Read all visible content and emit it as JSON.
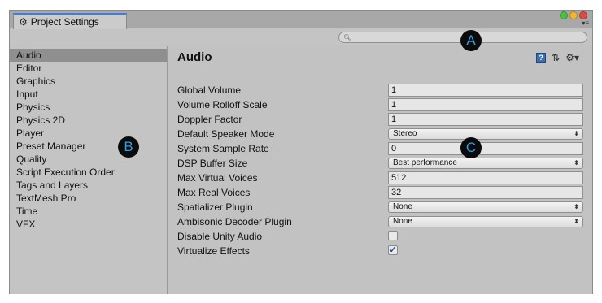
{
  "window": {
    "tab_title": "Project Settings"
  },
  "search": {
    "placeholder": "",
    "value": ""
  },
  "sidebar": {
    "items": [
      {
        "label": "Audio",
        "active": true
      },
      {
        "label": "Editor"
      },
      {
        "label": "Graphics"
      },
      {
        "label": "Input"
      },
      {
        "label": "Physics"
      },
      {
        "label": "Physics 2D"
      },
      {
        "label": "Player"
      },
      {
        "label": "Preset Manager"
      },
      {
        "label": "Quality"
      },
      {
        "label": "Script Execution Order"
      },
      {
        "label": "Tags and Layers"
      },
      {
        "label": "TextMesh Pro"
      },
      {
        "label": "Time"
      },
      {
        "label": "VFX"
      }
    ]
  },
  "main": {
    "title": "Audio",
    "settings": [
      {
        "label": "Global Volume",
        "type": "text",
        "value": "1"
      },
      {
        "label": "Volume Rolloff Scale",
        "type": "text",
        "value": "1"
      },
      {
        "label": "Doppler Factor",
        "type": "text",
        "value": "1"
      },
      {
        "label": "Default Speaker Mode",
        "type": "dropdown",
        "value": "Stereo"
      },
      {
        "label": "System Sample Rate",
        "type": "text",
        "value": "0"
      },
      {
        "label": "DSP Buffer Size",
        "type": "dropdown",
        "value": "Best performance"
      },
      {
        "label": "Max Virtual Voices",
        "type": "text",
        "value": "512"
      },
      {
        "label": "Max Real Voices",
        "type": "text",
        "value": "32"
      },
      {
        "label": "Spatializer Plugin",
        "type": "dropdown",
        "value": "None"
      },
      {
        "label": "Ambisonic Decoder Plugin",
        "type": "dropdown",
        "value": "None"
      },
      {
        "label": "Disable Unity Audio",
        "type": "checkbox",
        "checked": false
      },
      {
        "label": "Virtualize Effects",
        "type": "checkbox",
        "checked": true
      }
    ]
  },
  "callouts": {
    "a": "A",
    "b": "B",
    "c": "C"
  },
  "colors": {
    "window_bg": "#c2c2c2",
    "selected_item": "#8f8f8f",
    "tab_accent": "#3e7ce0",
    "callout_bg": "#0b0b0b",
    "callout_text": "#2da0e8"
  }
}
